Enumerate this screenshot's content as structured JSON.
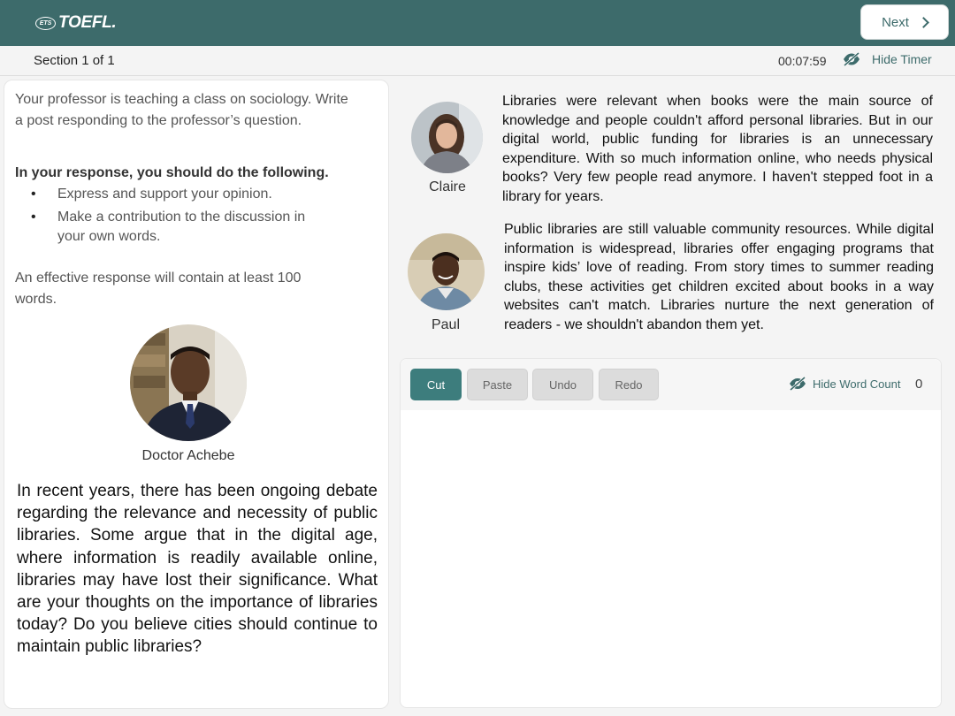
{
  "header": {
    "ets_badge": "ETS",
    "logo_text": "TOEFL.",
    "next_label": "Next"
  },
  "section": {
    "label": "Section 1 of 1",
    "timer": "00:07:59",
    "hide_timer_label": "Hide Timer"
  },
  "left": {
    "instruction": "Your professor is teaching a class on sociology. Write a post responding to the professor’s question.",
    "response_heading": "In your response, you should do the following.",
    "bullets": [
      "Express and support your opinion.",
      "Make a contribution to the discussion in your own words."
    ],
    "effective": "An effective response will contain at least 100 words.",
    "professor_name": "Doctor Achebe",
    "professor_question": "In recent years, there has been ongoing debate regarding the relevance and necessity of public libraries. Some argue that in the digital age, where information is readily available online, libraries may have lost their significance. What are your thoughts on the importance of libraries today? Do you believe cities should continue to maintain public libraries?"
  },
  "posts": [
    {
      "name": "Claire",
      "text": "Libraries were relevant when books were the main source of knowledge and people couldn't afford personal libraries. But in our digital world, public funding for libraries is an unnecessary expenditure. With so much information online, who needs physical books? Very few people read anymore. I haven't stepped foot in a library for years."
    },
    {
      "name": "Paul",
      "text": "Public libraries are still valuable community resources. While digital information is widespread, libraries offer engaging programs that inspire kids’ love of reading. From story times to summer reading clubs, these activities get children excited about books in a way websites can't match. Libraries nurture the next generation of readers - we shouldn't abandon them yet."
    }
  ],
  "editor": {
    "buttons": [
      "Cut",
      "Paste",
      "Undo",
      "Redo"
    ],
    "hide_word_count_label": "Hide Word Count",
    "word_count": "0",
    "content": ""
  },
  "icons": {
    "next": "chevron-right-icon",
    "hide_timer": "eye-slash-icon",
    "hide_word_count": "eye-slash-icon"
  },
  "colors": {
    "brand": "#3d6b6b",
    "accent_button": "#3d7d7d"
  }
}
